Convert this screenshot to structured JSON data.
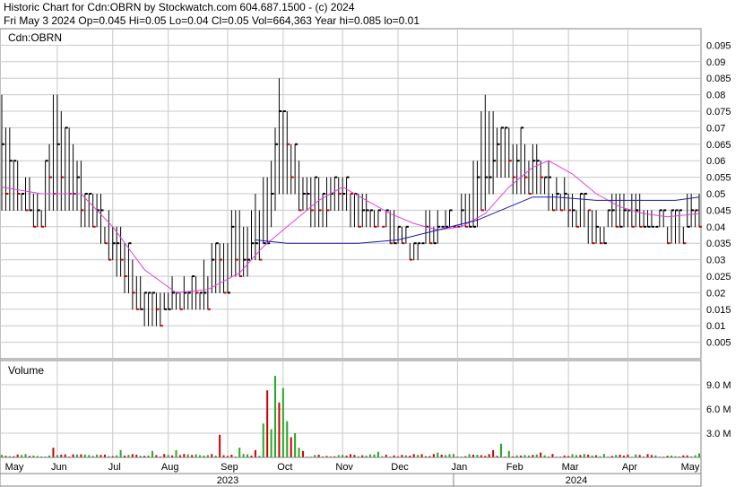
{
  "header": {
    "line1": "Historic Chart for Cdn:OBRN by Stockwatch.com 604.687.1500 - (c) 2024",
    "line2": "Fri May  3 2024   Op=0.045  Hi=0.05  Lo=0.04  Cl=0.05  Vol=664,363  Year hi=0.085  lo=0.01"
  },
  "colors": {
    "up": "#000000",
    "down": "#cc0000",
    "vol_up": "#22aa22",
    "vol_down": "#cc0000",
    "ma_short": "#e040e0",
    "ma_long": "#1a1aaa",
    "grid": "#c8c8c8"
  },
  "chart_data": [
    {
      "type": "bar",
      "panel": "price",
      "label": "Cdn:OBRN",
      "ylim": [
        0.0,
        0.1
      ],
      "y_ticks": [
        "0.005",
        "0.01",
        "0.015",
        "0.02",
        "0.025",
        "0.03",
        "0.035",
        "0.04",
        "0.045",
        "0.05",
        "0.055",
        "0.06",
        "0.065",
        "0.07",
        "0.075",
        "0.08",
        "0.085",
        "0.09",
        "0.095"
      ],
      "x_tick_labels": [
        "May",
        "Jun",
        "Jul",
        "Aug",
        "Sep",
        "Oct",
        "Nov",
        "Dec",
        "Jan",
        "Feb",
        "Mar",
        "Apr",
        "May"
      ],
      "year_labels": [
        "2023",
        "2024"
      ],
      "grid": true,
      "series_note_values": {
        "anchors": [
          [
            0,
            0.08,
            0.045
          ],
          [
            5,
            0.055,
            0.045
          ],
          [
            10,
            0.05,
            0.04
          ],
          [
            13,
            0.08,
            0.045
          ],
          [
            17,
            0.07,
            0.045
          ],
          [
            23,
            0.05,
            0.04
          ],
          [
            28,
            0.045,
            0.03
          ],
          [
            33,
            0.03,
            0.015
          ],
          [
            38,
            0.02,
            0.01
          ],
          [
            44,
            0.025,
            0.015
          ],
          [
            50,
            0.025,
            0.015
          ],
          [
            55,
            0.04,
            0.02
          ],
          [
            60,
            0.045,
            0.025
          ],
          [
            65,
            0.05,
            0.03
          ],
          [
            68,
            0.06,
            0.04
          ],
          [
            70,
            0.085,
            0.05
          ],
          [
            72,
            0.075,
            0.05
          ],
          [
            76,
            0.06,
            0.045
          ],
          [
            80,
            0.055,
            0.04
          ],
          [
            85,
            0.055,
            0.045
          ],
          [
            90,
            0.05,
            0.04
          ],
          [
            95,
            0.045,
            0.04
          ],
          [
            100,
            0.045,
            0.035
          ],
          [
            104,
            0.04,
            0.03
          ],
          [
            108,
            0.045,
            0.035
          ],
          [
            114,
            0.045,
            0.04
          ],
          [
            118,
            0.05,
            0.04
          ],
          [
            122,
            0.08,
            0.045
          ],
          [
            126,
            0.07,
            0.055
          ],
          [
            130,
            0.07,
            0.05
          ],
          [
            135,
            0.065,
            0.05
          ],
          [
            140,
            0.055,
            0.045
          ],
          [
            145,
            0.05,
            0.04
          ],
          [
            150,
            0.045,
            0.035
          ],
          [
            155,
            0.05,
            0.04
          ],
          [
            160,
            0.05,
            0.04
          ],
          [
            165,
            0.045,
            0.04
          ],
          [
            170,
            0.045,
            0.035
          ],
          [
            176,
            0.05,
            0.04
          ]
        ],
        "closes": [
          0.065,
          0.045,
          0.05,
          0.04,
          0.07,
          0.045,
          0.05,
          0.04,
          0.045,
          0.025,
          0.015,
          0.02,
          0.02,
          0.015,
          0.025,
          0.03,
          0.04,
          0.05,
          0.085,
          0.07,
          0.055,
          0.05,
          0.05,
          0.045,
          0.045,
          0.04,
          0.035,
          0.04,
          0.04,
          0.045,
          0.08,
          0.065,
          0.065,
          0.06,
          0.05,
          0.045,
          0.04,
          0.045,
          0.045,
          0.045,
          0.04,
          0.04,
          0.05
        ]
      },
      "ma_short": [
        [
          0,
          0.052
        ],
        [
          10,
          0.05
        ],
        [
          20,
          0.05
        ],
        [
          28,
          0.04
        ],
        [
          36,
          0.027
        ],
        [
          44,
          0.02
        ],
        [
          52,
          0.021
        ],
        [
          60,
          0.026
        ],
        [
          66,
          0.034
        ],
        [
          72,
          0.04
        ],
        [
          80,
          0.048
        ],
        [
          86,
          0.052
        ],
        [
          92,
          0.048
        ],
        [
          98,
          0.044
        ],
        [
          104,
          0.041
        ],
        [
          110,
          0.039
        ],
        [
          116,
          0.04
        ],
        [
          122,
          0.044
        ],
        [
          128,
          0.052
        ],
        [
          134,
          0.058
        ],
        [
          138,
          0.06
        ],
        [
          144,
          0.056
        ],
        [
          150,
          0.05
        ],
        [
          156,
          0.046
        ],
        [
          162,
          0.044
        ],
        [
          168,
          0.043
        ],
        [
          176,
          0.044
        ]
      ],
      "ma_long": [
        [
          64,
          0.036
        ],
        [
          72,
          0.035
        ],
        [
          80,
          0.035
        ],
        [
          90,
          0.035
        ],
        [
          100,
          0.036
        ],
        [
          110,
          0.039
        ],
        [
          120,
          0.042
        ],
        [
          128,
          0.046
        ],
        [
          134,
          0.049
        ],
        [
          140,
          0.049
        ],
        [
          150,
          0.048
        ],
        [
          160,
          0.048
        ],
        [
          170,
          0.048
        ],
        [
          176,
          0.049
        ]
      ]
    },
    {
      "type": "bar",
      "panel": "volume",
      "label": "Volume",
      "ylim": [
        0,
        12000000
      ],
      "y_ticks": [
        "3.0 M",
        "6.0 M",
        "9.0 M"
      ],
      "spikes": [
        [
          13,
          1.2
        ],
        [
          30,
          0.9
        ],
        [
          38,
          0.8
        ],
        [
          44,
          0.9
        ],
        [
          55,
          2.8
        ],
        [
          60,
          1.2
        ],
        [
          64,
          0.9
        ],
        [
          66,
          4.2
        ],
        [
          67,
          8.3
        ],
        [
          68,
          3.5
        ],
        [
          69,
          10.1
        ],
        [
          70,
          6.8
        ],
        [
          71,
          8.6
        ],
        [
          72,
          4.5
        ],
        [
          73,
          2.5
        ],
        [
          74,
          3.0
        ],
        [
          75,
          1.2
        ],
        [
          76,
          0.8
        ],
        [
          95,
          0.7
        ],
        [
          110,
          0.6
        ],
        [
          124,
          0.9
        ],
        [
          126,
          1.7
        ],
        [
          128,
          0.8
        ],
        [
          136,
          0.6
        ],
        [
          176,
          0.5
        ]
      ]
    }
  ]
}
